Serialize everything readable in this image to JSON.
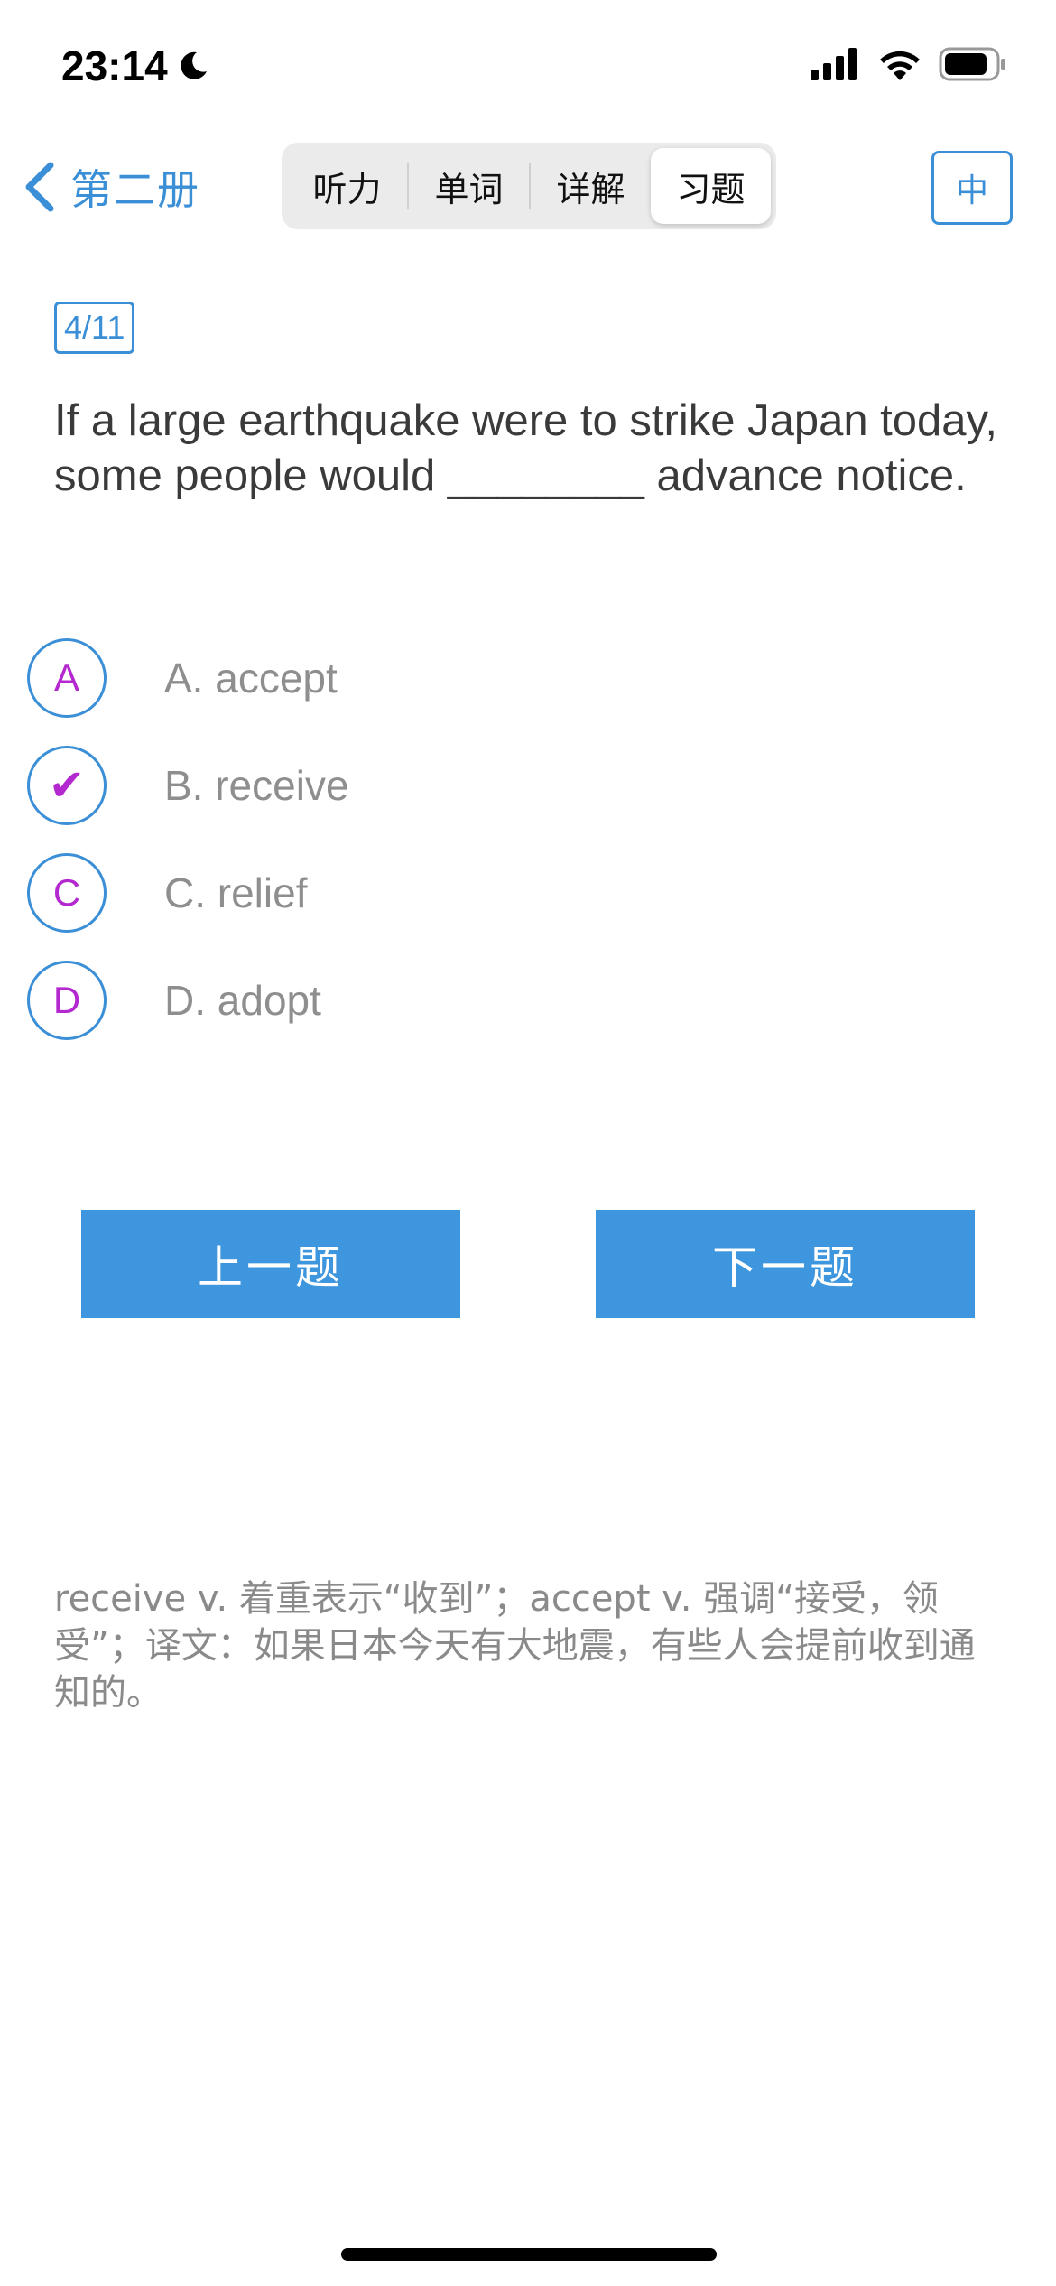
{
  "status_bar": {
    "time": "23:14"
  },
  "nav": {
    "back_label": "第二册",
    "tabs": [
      {
        "label": "听力",
        "active": false
      },
      {
        "label": "单词",
        "active": false
      },
      {
        "label": "详解",
        "active": false
      },
      {
        "label": "习题",
        "active": true
      }
    ],
    "language_button": "中"
  },
  "question": {
    "counter": "4/11",
    "text": "If a large earthquake were to strike Japan today, some people would ________ advance notice."
  },
  "options": [
    {
      "marker": "A",
      "label": "A. accept",
      "selected": false
    },
    {
      "marker": "✔",
      "label": "B. receive",
      "selected": true
    },
    {
      "marker": "C",
      "label": "C. relief",
      "selected": false
    },
    {
      "marker": "D",
      "label": "D. adopt",
      "selected": false
    }
  ],
  "buttons": {
    "prev": "上一题",
    "next": "下一题"
  },
  "explanation": "receive v. 着重表示“收到”；accept v. 强调“接受，领受”；译文：如果日本今天有大地震，有些人会提前收到通知的。",
  "colors": {
    "accent": "#3b8fd6",
    "button": "#3d96de",
    "marker": "#b428d0",
    "option_text": "#8e8e8e"
  }
}
